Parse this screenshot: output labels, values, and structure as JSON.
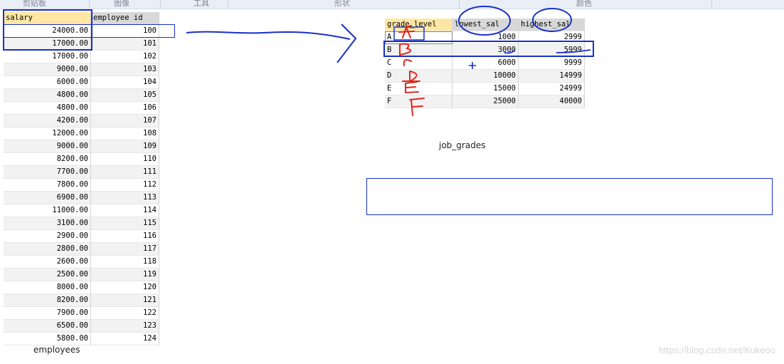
{
  "ribbon": {
    "groups": [
      "剪贴板",
      "图像",
      "工具",
      "形状",
      "颜色"
    ]
  },
  "employees": {
    "columns": [
      "salary",
      "employee id"
    ],
    "rows": [
      [
        "24000.00",
        "100"
      ],
      [
        "17000.00",
        "101"
      ],
      [
        "17000.00",
        "102"
      ],
      [
        "9000.00",
        "103"
      ],
      [
        "6000.00",
        "104"
      ],
      [
        "4800.00",
        "105"
      ],
      [
        "4800.00",
        "106"
      ],
      [
        "4200.00",
        "107"
      ],
      [
        "12000.00",
        "108"
      ],
      [
        "9000.00",
        "109"
      ],
      [
        "8200.00",
        "110"
      ],
      [
        "7700.00",
        "111"
      ],
      [
        "7800.00",
        "112"
      ],
      [
        "6900.00",
        "113"
      ],
      [
        "11000.00",
        "114"
      ],
      [
        "3100.00",
        "115"
      ],
      [
        "2900.00",
        "116"
      ],
      [
        "2800.00",
        "117"
      ],
      [
        "2600.00",
        "118"
      ],
      [
        "2500.00",
        "119"
      ],
      [
        "8000.00",
        "120"
      ],
      [
        "8200.00",
        "121"
      ],
      [
        "7900.00",
        "122"
      ],
      [
        "6500.00",
        "123"
      ],
      [
        "5800.00",
        "124"
      ]
    ],
    "caption": "employees"
  },
  "job_grades": {
    "columns": [
      "grade_level",
      "lowest_sal",
      "highest_sal"
    ],
    "rows": [
      [
        "A",
        "1000",
        "2999"
      ],
      [
        "B",
        "3000",
        "5999"
      ],
      [
        "C",
        "6000",
        "9999"
      ],
      [
        "D",
        "10000",
        "14999"
      ],
      [
        "E",
        "15000",
        "24999"
      ],
      [
        "F",
        "25000",
        "40000"
      ]
    ],
    "caption": "job_grades"
  },
  "annotations": {
    "handwritten_letters": [
      "A",
      "B",
      "C",
      "D",
      "E",
      "F"
    ],
    "ink_red": "#e0261c",
    "ink_blue": "#1830c8"
  },
  "watermark": "https://blog.csdn.net/Kukeoo"
}
